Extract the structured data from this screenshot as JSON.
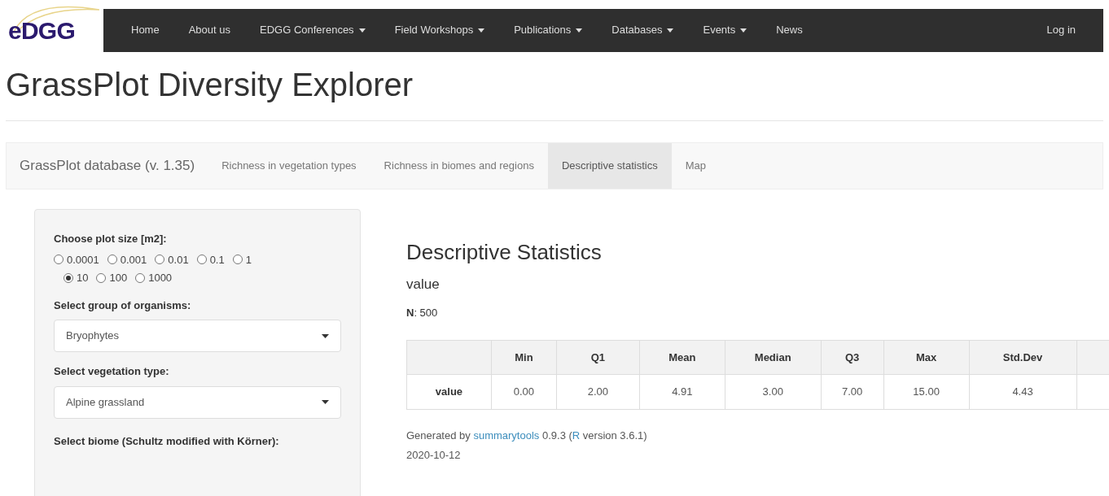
{
  "navbar": {
    "logo": "eDGG",
    "items": [
      {
        "label": "Home",
        "dropdown": false
      },
      {
        "label": "About us",
        "dropdown": false
      },
      {
        "label": "EDGG Conferences",
        "dropdown": true
      },
      {
        "label": "Field Workshops",
        "dropdown": true
      },
      {
        "label": "Publications",
        "dropdown": true
      },
      {
        "label": "Databases",
        "dropdown": true
      },
      {
        "label": "Events",
        "dropdown": true
      },
      {
        "label": "News",
        "dropdown": false
      }
    ],
    "login": "Log in"
  },
  "page_title": "GrassPlot Diversity Explorer",
  "tabs": {
    "brand": "GrassPlot database (v. 1.35)",
    "items": [
      {
        "label": "Richness in vegetation types",
        "selected": false
      },
      {
        "label": "Richness in biomes and regions",
        "selected": false
      },
      {
        "label": "Descriptive statistics",
        "selected": true
      },
      {
        "label": "Map",
        "selected": false
      }
    ]
  },
  "sidebar": {
    "plot_size": {
      "label": "Choose plot size [m2]:",
      "options": [
        {
          "label": "0.0001",
          "selected": false
        },
        {
          "label": "0.001",
          "selected": false
        },
        {
          "label": "0.01",
          "selected": false
        },
        {
          "label": "0.1",
          "selected": false
        },
        {
          "label": "1",
          "selected": false
        },
        {
          "label": "10",
          "selected": true
        },
        {
          "label": "100",
          "selected": false
        },
        {
          "label": "1000",
          "selected": false
        }
      ]
    },
    "selects": [
      {
        "label": "Select group of organisms:",
        "value": "Bryophytes"
      },
      {
        "label": "Select vegetation type:",
        "value": "Alpine grassland"
      }
    ],
    "biome_label": "Select biome (Schultz modified with Körner):"
  },
  "main": {
    "heading": "Descriptive Statistics",
    "subheading": "value",
    "n": "**N**: 500",
    "table": {
      "columns": [
        "Min",
        "Q1",
        "Mean",
        "Median",
        "Q3",
        "Max",
        "Std.Dev"
      ],
      "rows": [
        {
          "label": "value",
          "cells": [
            "0.00",
            "2.00",
            "4.91",
            "3.00",
            "7.00",
            "15.00",
            "4.43"
          ]
        }
      ]
    },
    "footer": {
      "prefix": "Generated by",
      "link1": "summarytools",
      "middle": "0.9.3 (",
      "link2": "R",
      "suffix": "version 3.6.1)",
      "date": "2020-10-12"
    }
  }
}
